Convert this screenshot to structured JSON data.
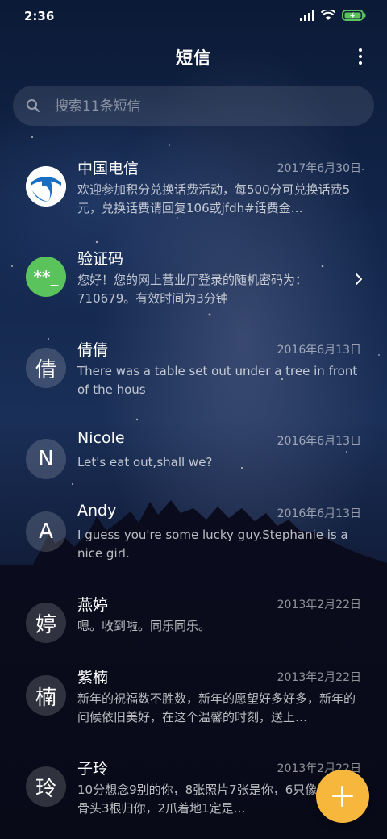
{
  "status_bar": {
    "time": "2:36"
  },
  "header": {
    "title": "短信"
  },
  "search": {
    "placeholder": "搜索11条短信"
  },
  "messages": [
    {
      "name": "中国电信",
      "date": "2017年6月30日",
      "preview": "欢迎参加积分兑换话费活动，每500分可兑换话费5元，兑换话费请回复106或jfdh#话费金…",
      "avatar_icon": "china-telecom-logo-icon"
    },
    {
      "name": "验证码",
      "date": "",
      "preview": "您好！您的网上营业厅登录的随机密码为：710679。有效时间为3分钟",
      "avatar_text": "**_",
      "avatar_color": "#5ac35c"
    },
    {
      "name": "倩倩",
      "date": "2016年6月13日",
      "preview": "There was a table set out under a tree in front of the hous",
      "avatar_text": "倩"
    },
    {
      "name": "Nicole",
      "date": "2016年6月13日",
      "preview": "Let's eat out,shall we?",
      "avatar_text": "N"
    },
    {
      "name": "Andy",
      "date": "2016年6月13日",
      "preview": "I guess you're some lucky guy.Stephanie is a nice girl.",
      "avatar_text": "A"
    },
    {
      "name": "燕婷",
      "date": "2013年2月22日",
      "preview": "嗯。收到啦。同乐同乐。",
      "avatar_text": "婷"
    },
    {
      "name": "紫楠",
      "date": "2013年2月22日",
      "preview": "新年的祝福数不胜数，新年的愿望好多好多，新年的问候依旧美好，在这个温馨的时刻，送上…",
      "avatar_text": "楠"
    },
    {
      "name": "子玲",
      "date": "2013年2月22日",
      "preview": "10分想念9别的你，8张照片7张是你，6只像你，4根骨头3根归你，2爪着地1定是…",
      "avatar_text": "玲"
    }
  ],
  "colors": {
    "fab": "#f6b73c",
    "accent_green": "#5ac35c"
  }
}
